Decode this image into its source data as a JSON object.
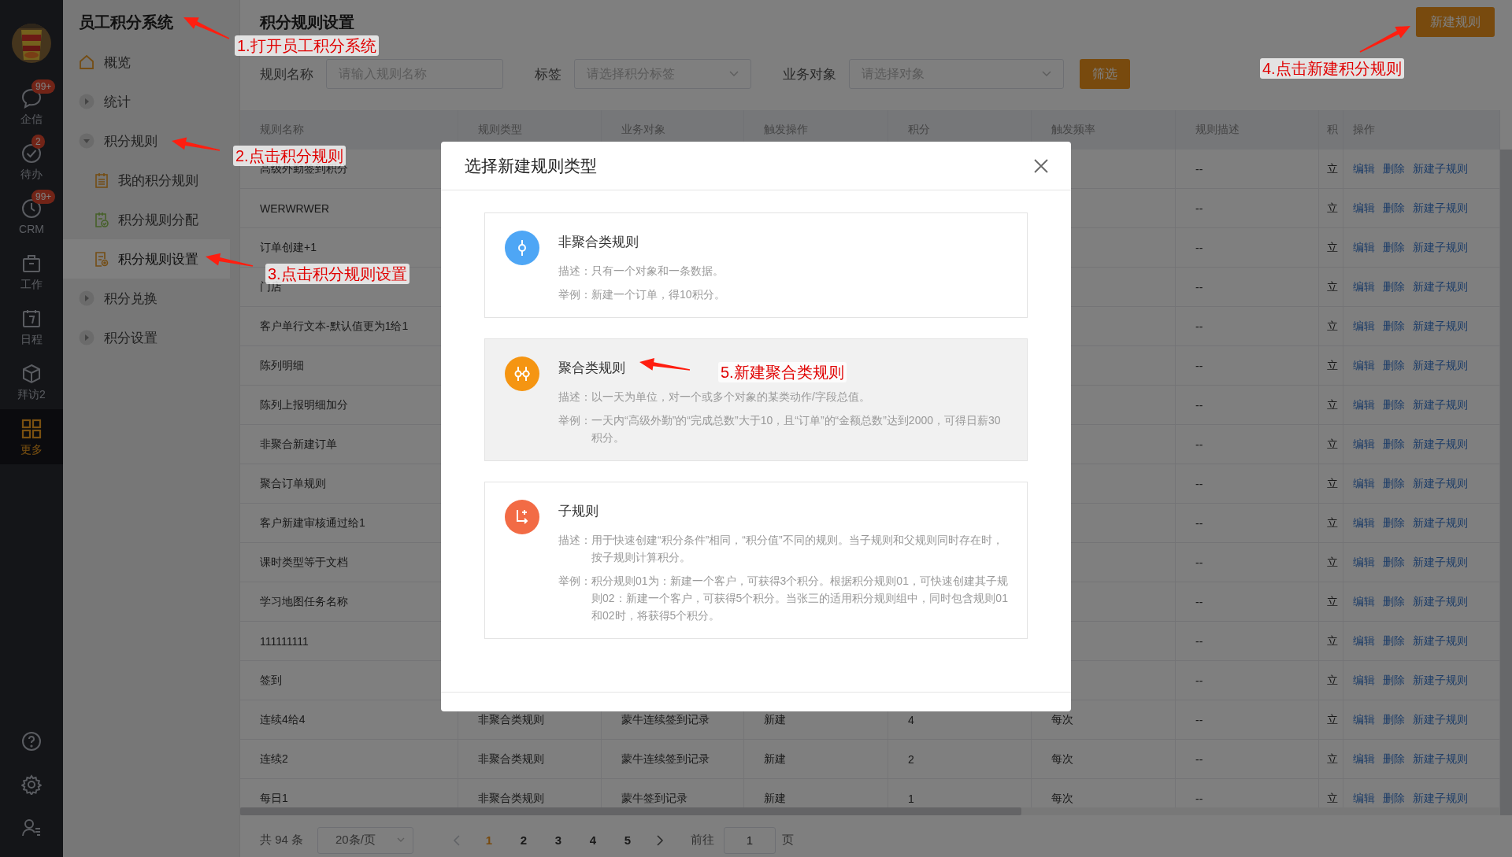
{
  "rail": {
    "items": [
      {
        "kind": "chat",
        "label": "企信",
        "badge": "99+",
        "selected": false
      },
      {
        "kind": "check",
        "label": "待办",
        "badge": "2",
        "selected": false
      },
      {
        "kind": "clock",
        "label": "CRM",
        "badge": "99+",
        "selected": false
      },
      {
        "kind": "briefcase",
        "label": "工作",
        "selected": false
      },
      {
        "kind": "calendar",
        "label": "日程",
        "selected": false
      },
      {
        "kind": "cube",
        "label": "拜访2",
        "selected": false
      },
      {
        "kind": "grid",
        "label": "更多",
        "selected": true
      }
    ]
  },
  "sidebar": {
    "title": "员工积分系统",
    "items": [
      {
        "kind": "home",
        "label": "概览",
        "selected": false
      },
      {
        "kind": "group",
        "label": "统计",
        "expanded": false,
        "selected": false
      },
      {
        "kind": "group",
        "label": "积分规则",
        "expanded": true,
        "selected": false,
        "children": [
          {
            "kind": "doc",
            "label": "我的积分规则",
            "selected": false
          },
          {
            "kind": "doc-check",
            "label": "积分规则分配",
            "selected": false
          },
          {
            "kind": "doc-gear",
            "label": "积分规则设置",
            "selected": true
          }
        ]
      },
      {
        "kind": "group",
        "label": "积分兑换",
        "expanded": false,
        "selected": false
      },
      {
        "kind": "group",
        "label": "积分设置",
        "expanded": false,
        "selected": false
      }
    ]
  },
  "page": {
    "title": "积分规则设置",
    "new_button": "新建规则"
  },
  "filters": {
    "fields": [
      {
        "kind": "input",
        "label": "规则名称",
        "placeholder": "请输入规则名称"
      },
      {
        "kind": "select",
        "label": "标签",
        "placeholder": "请选择积分标签"
      },
      {
        "kind": "select",
        "label": "业务对象",
        "placeholder": "请选择对象"
      }
    ],
    "button": "筛选"
  },
  "table": {
    "columns": [
      "规则名称",
      "规则类型",
      "业务对象",
      "触发操作",
      "积分",
      "触发频率",
      "规则描述",
      "积",
      "操作"
    ],
    "rows": [
      {
        "name": "高级外勤签到积分",
        "description": "--",
        "column_8": "立",
        "actions": [
          "编辑",
          "删除",
          "新建子规则"
        ]
      },
      {
        "name": "WERWRWER",
        "description": "--",
        "column_8": "立",
        "actions": [
          "编辑",
          "删除",
          "新建子规则"
        ]
      },
      {
        "name": "订单创建+1",
        "description": "--",
        "column_8": "立",
        "actions": [
          "编辑",
          "删除",
          "新建子规则"
        ]
      },
      {
        "name": "门店",
        "description": "--",
        "column_8": "立",
        "actions": [
          "编辑",
          "删除",
          "新建子规则"
        ]
      },
      {
        "name": "客户单行文本-默认值更为1给1",
        "description": "--",
        "column_8": "立",
        "actions": [
          "编辑",
          "删除",
          "新建子规则"
        ]
      },
      {
        "name": "陈列明细",
        "description": "--",
        "column_8": "立",
        "actions": [
          "编辑",
          "删除",
          "新建子规则"
        ]
      },
      {
        "name": "陈列上报明细加分",
        "description": "--",
        "column_8": "立",
        "actions": [
          "编辑",
          "删除",
          "新建子规则"
        ]
      },
      {
        "name": "非聚合新建订单",
        "description": "--",
        "column_8": "立",
        "actions": [
          "编辑",
          "删除",
          "新建子规则"
        ]
      },
      {
        "name": "聚合订单规则",
        "description": "--",
        "column_8": "立",
        "actions": [
          "编辑",
          "删除",
          "新建子规则"
        ]
      },
      {
        "name": "客户新建审核通过给1",
        "description": "--",
        "column_8": "立",
        "actions": [
          "编辑",
          "删除",
          "新建子规则"
        ]
      },
      {
        "name": "课时类型等于文档",
        "description": "--",
        "column_8": "立",
        "actions": [
          "编辑",
          "删除",
          "新建子规则"
        ]
      },
      {
        "name": "学习地图任务名称",
        "description": "--",
        "column_8": "立",
        "actions": [
          "编辑",
          "删除",
          "新建子规则"
        ]
      },
      {
        "name": "111111111",
        "description": "--",
        "column_8": "立",
        "actions": [
          "编辑",
          "删除",
          "新建子规则"
        ]
      },
      {
        "name": "签到",
        "description": "--",
        "column_8": "立",
        "actions": [
          "编辑",
          "删除",
          "新建子规则"
        ]
      },
      {
        "name": "连续4给4",
        "type": "非聚合类规则",
        "object": "蒙牛连续签到记录",
        "action": "新建",
        "points": "4",
        "frequency": "每次",
        "description": "--",
        "column_8": "立",
        "actions": [
          "编辑",
          "删除",
          "新建子规则"
        ]
      },
      {
        "name": "连续2",
        "type": "非聚合类规则",
        "object": "蒙牛连续签到记录",
        "action": "新建",
        "points": "2",
        "frequency": "每次",
        "description": "--",
        "column_8": "立",
        "actions": [
          "编辑",
          "删除",
          "新建子规则"
        ]
      },
      {
        "name": "每日1",
        "type": "非聚合类规则",
        "object": "蒙牛签到记录",
        "action": "新建",
        "points": "1",
        "frequency": "每次",
        "description": "--",
        "column_8": "立",
        "actions": [
          "编辑",
          "删除",
          "新建子规则"
        ]
      }
    ]
  },
  "pagination": {
    "total": "共 94 条",
    "page_size": "20条/页",
    "pages": [
      {
        "label": "1",
        "selected": true
      },
      {
        "label": "2",
        "selected": false
      },
      {
        "label": "3",
        "selected": false
      },
      {
        "label": "4",
        "selected": false
      },
      {
        "label": "5",
        "selected": false
      }
    ],
    "goto_label": "前往",
    "goto_value": "1",
    "goto_suffix": "页"
  },
  "modal": {
    "title": "选择新建规则类型",
    "cards": [
      {
        "kind": "single",
        "title": "非聚合类规则",
        "selected": false,
        "lines": [
          {
            "label": "描述：",
            "text": "只有一个对象和一条数据。"
          },
          {
            "label": "举例：",
            "text": "新建一个订单，得10积分。"
          }
        ]
      },
      {
        "kind": "aggregate",
        "title": "聚合类规则",
        "selected": true,
        "lines": [
          {
            "label": "描述：",
            "text": "以一天为单位，对一个或多个对象的某类动作/字段总值。"
          },
          {
            "label": "举例：",
            "text": "一天内“高级外勤”的“完成总数”大于10，且“订单”的“金额总数”达到2000，可得日薪30积分。"
          }
        ]
      },
      {
        "kind": "child",
        "title": "子规则",
        "selected": false,
        "lines": [
          {
            "label": "描述：",
            "text": "用于快速创建“积分条件”相同，“积分值”不同的规则。当子规则和父规则同时存在时，按子规则计算积分。"
          },
          {
            "label": "举例：",
            "text": "积分规则01为：新建一个客户，可获得3个积分。根据积分规则01，可快速创建其子规则02：新建一个客户，可获得5个积分。当张三的适用积分规则组中，同时包含规则01和02时，将获得5个积分。"
          }
        ]
      }
    ]
  },
  "annotations": [
    {
      "text": "1.打开员工积分系统"
    },
    {
      "text": "2.点击积分规则"
    },
    {
      "text": "3.点击积分规则设置"
    },
    {
      "text": "4.点击新建积分规则"
    },
    {
      "text": "5.新建聚合类规则"
    }
  ]
}
